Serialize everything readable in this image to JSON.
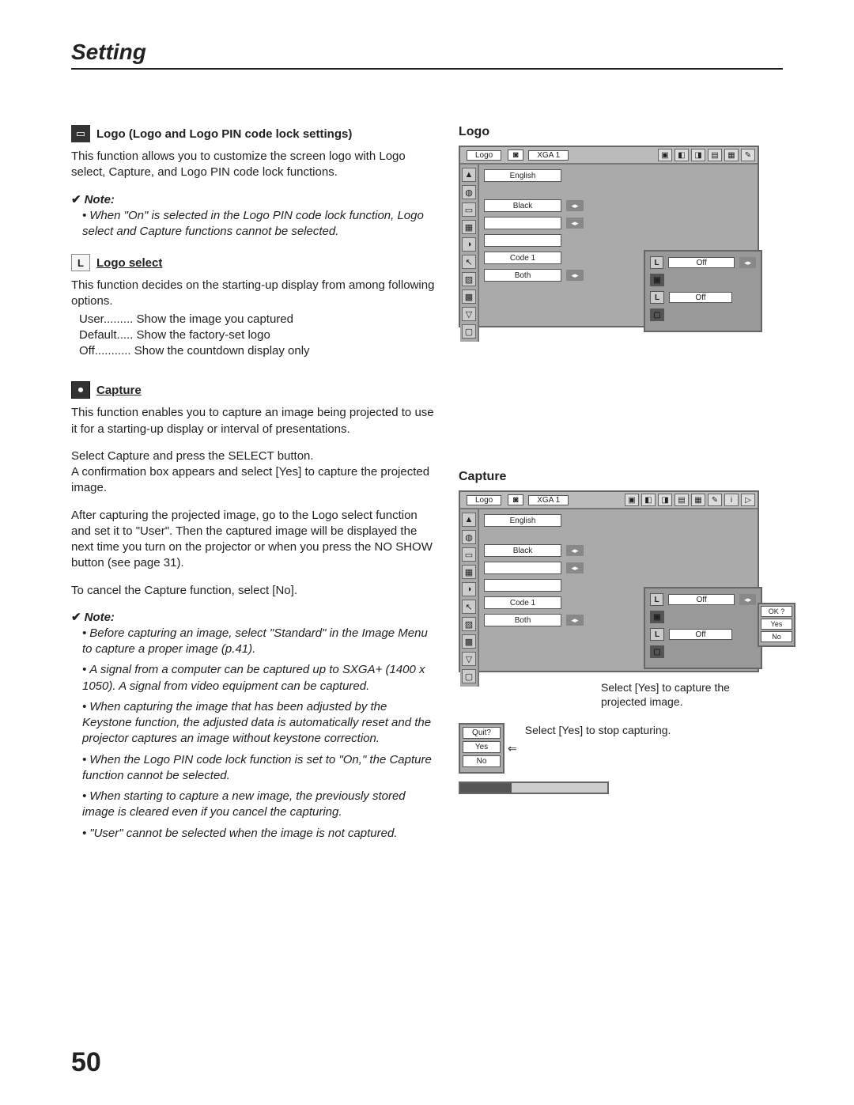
{
  "header": {
    "title": "Setting"
  },
  "page_number": "50",
  "left": {
    "logo_section": {
      "title": "Logo (Logo and Logo PIN code lock settings)",
      "body": "This function allows you to customize the screen logo with Logo select, Capture, and Logo PIN code lock functions.",
      "note_label": "Note:",
      "note_items": [
        "When \"On\" is selected in the Logo PIN code lock function, Logo select and Capture functions cannot be selected."
      ]
    },
    "logo_select": {
      "title": "Logo select",
      "body": "This function decides on the starting-up display from among following options.",
      "defs": [
        {
          "term": "User",
          "dots": ".........",
          "desc": "Show the image you captured"
        },
        {
          "term": "Default",
          "dots": ".....",
          "desc": "Show the factory-set logo"
        },
        {
          "term": "Off",
          "dots": "...........",
          "desc": "Show the countdown display only"
        }
      ]
    },
    "capture": {
      "title": "Capture",
      "body1": "This function enables you to capture an image being projected to use it for a starting-up display or interval of presentations.",
      "body2": "Select Capture and press the SELECT button.\nA confirmation box appears and select [Yes] to capture the projected image.",
      "body3": "After capturing the projected image, go to the Logo select function and set it to \"User\". Then the captured image will be displayed the next time you turn on the projector or when you press the NO SHOW button (see page 31).",
      "body4": "To cancel the Capture function, select [No].",
      "note_label": "Note:",
      "note_items": [
        "Before capturing an image, select \"Standard\" in the Image Menu to capture a proper image (p.41).",
        "A signal from a computer can be captured up to SXGA+ (1400 x 1050). A signal from video equipment can be captured.",
        "When capturing the image that has been adjusted by the Keystone function, the adjusted data is automatically reset and the projector captures an image without keystone correction.",
        "When the Logo PIN code lock function is set to \"On,\" the Capture function cannot be selected.",
        "When starting to capture a new image, the previously stored image is cleared even if you cancel the capturing.",
        "\"User\" cannot be selected when the image is not captured."
      ]
    }
  },
  "right": {
    "logo_heading": "Logo",
    "capture_heading": "Capture",
    "signal_label": "XGA 1",
    "menu_label": "Logo",
    "menu_rows": [
      "English",
      "Black",
      "",
      "",
      "Code 1",
      "Both"
    ],
    "sub_off": "Off",
    "ok_popup": {
      "ok": "OK ?",
      "yes": "Yes",
      "no": "No"
    },
    "caption1": "Select [Yes] to capture the projected image.",
    "quit_popup": {
      "quit": "Quit?",
      "yes": "Yes",
      "no": "No"
    },
    "caption2": "Select [Yes] to stop capturing."
  }
}
